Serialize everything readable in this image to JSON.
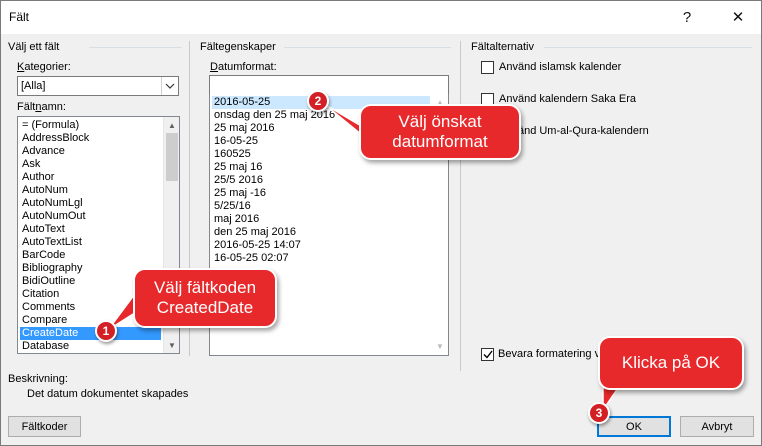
{
  "window": {
    "title": "Fält",
    "help": "?",
    "close": "✕"
  },
  "left": {
    "group": "Välj ett fält",
    "categories_label_u": "K",
    "categories_label_rest": "ategorier:",
    "categories_value": "[Alla]",
    "fieldnames_label_a": "Fält",
    "fieldnames_label_u": "n",
    "fieldnames_label_b": "amn:",
    "fields": [
      "= (Formula)",
      "AddressBlock",
      "Advance",
      "Ask",
      "Author",
      "AutoNum",
      "AutoNumLgl",
      "AutoNumOut",
      "AutoText",
      "AutoTextList",
      "BarCode",
      "Bibliography",
      "BidiOutline",
      "Citation",
      "Comments",
      "Compare",
      "CreateDate",
      "Database"
    ],
    "selected_field": "CreateDate"
  },
  "middle": {
    "group": "Fältegenskaper",
    "format_label_u": "D",
    "format_label_rest": "atumformat:",
    "format_input": "",
    "formats": [
      "2016-05-25",
      "onsdag den 25 maj 2016",
      "25 maj 2016",
      "16-05-25",
      "160525",
      "25 maj 16",
      "25/5 2016",
      "25 maj -16",
      "5/25/16",
      "maj 2016",
      "den 25 maj 2016",
      "2016-05-25 14:07",
      "16-05-25 02:07"
    ],
    "selected_format": "2016-05-25"
  },
  "right": {
    "group": "Fältalternativ",
    "options": [
      {
        "label": "Använd islamsk kalender",
        "checked": false
      },
      {
        "label": "Använd kalendern Saka Era",
        "checked": false
      },
      {
        "label": "Använd Um-al-Qura-kalendern",
        "checked": false
      }
    ],
    "preserve": {
      "label": "Bevara formatering vid uppdateringar",
      "checked": true
    }
  },
  "description": {
    "heading": "Beskrivning:",
    "text": "Det datum dokumentet skapades"
  },
  "buttons": {
    "field_codes": "Fältkoder",
    "ok": "OK",
    "cancel": "Avbryt"
  },
  "annotations": {
    "callout1": "Välj fältkoden CreatedDate",
    "callout2": "Välj önskat datumformat",
    "callout3": "Klicka på OK",
    "badge1": "1",
    "badge2": "2",
    "badge3": "3",
    "color": "#e8292c"
  }
}
